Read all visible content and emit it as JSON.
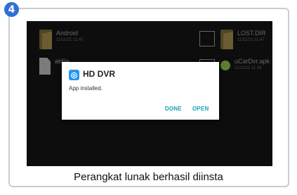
{
  "step_number": "4",
  "files": [
    {
      "name": "Android",
      "date": "11/11/21 11:47",
      "icon": "folder-icon"
    },
    {
      "name": "LOST.DIR",
      "date": "11/11/21 11:47",
      "icon": "folder-icon"
    },
    {
      "name": "akfile",
      "date": "",
      "icon": "document-icon"
    },
    {
      "name": "uCarDvr.apk",
      "date": "11/11/21 11:38",
      "icon": "apk-icon"
    }
  ],
  "dialog": {
    "app_name": "HD DVR",
    "message": "App installed.",
    "done_label": "DONE",
    "open_label": "OPEN",
    "accent_color": "#17a2b8"
  },
  "caption": "Perangkat lunak berhasil diinsta"
}
